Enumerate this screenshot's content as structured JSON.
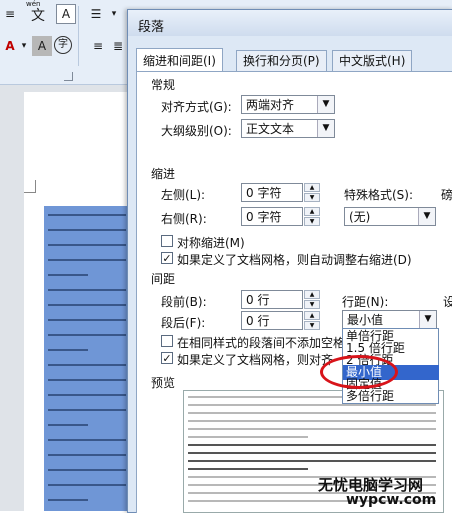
{
  "ribbon": {
    "wen_label": "wén",
    "wen_char": "文",
    "a_box": "A",
    "a_big": "A",
    "a_red": "A",
    "a_shade": "A",
    "circle_char": "字"
  },
  "dialog": {
    "title": "段落",
    "tabs": [
      "缩进和间距(I)",
      "换行和分页(P)",
      "中文版式(H)"
    ],
    "general": {
      "heading": "常规",
      "alignment_label": "对齐方式(G):",
      "alignment_value": "两端对齐",
      "outline_label": "大纲级别(O):",
      "outline_value": "正文文本"
    },
    "indent": {
      "heading": "缩进",
      "left_label": "左侧(L):",
      "left_value": "0 字符",
      "right_label": "右侧(R):",
      "right_value": "0 字符",
      "special_label": "特殊格式(S):",
      "special_value": "(无)",
      "special_cut": "磅",
      "mirror_label": "对称缩进(M)",
      "auto_label": "如果定义了文档网格，则自动调整右缩进(D)"
    },
    "spacing": {
      "heading": "间距",
      "before_label": "段前(B):",
      "before_value": "0 行",
      "after_label": "段后(F):",
      "after_value": "0 行",
      "line_label": "行距(N):",
      "line_value": "最小值",
      "line_cut": "设",
      "no_space_label": "在相同样式的段落间不添加空格",
      "grid_label": "如果定义了文档网格，则对齐"
    },
    "line_options": [
      "单倍行距",
      "1.5 倍行距",
      "2 倍行距",
      "最小值",
      "固定值",
      "多倍行距"
    ],
    "highlighted_option": "最小值",
    "preview_heading": "预览"
  },
  "watermark": {
    "line1": "无忧电脑学习网",
    "line2": "wypcw.com"
  },
  "colors": {
    "accent": "#3366cc",
    "selection": "#6f96d6",
    "annotation": "#d8141a"
  }
}
